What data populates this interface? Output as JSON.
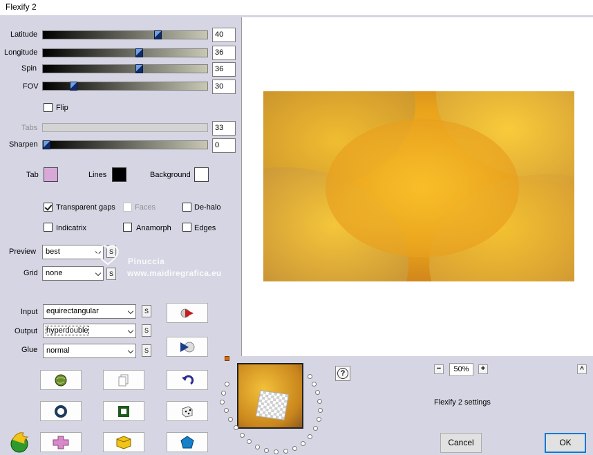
{
  "window": {
    "title": "Flexify 2"
  },
  "sliders": {
    "latitude": {
      "label": "Latitude",
      "value": "40",
      "fraction": 0.71
    },
    "longitude": {
      "label": "Longitude",
      "value": "36",
      "fraction": 0.59
    },
    "spin": {
      "label": "Spin",
      "value": "36",
      "fraction": 0.59
    },
    "fov": {
      "label": "FOV",
      "value": "30",
      "fraction": 0.17
    },
    "tabs": {
      "label": "Tabs",
      "value": "33",
      "disabled": true
    },
    "sharpen": {
      "label": "Sharpen",
      "value": "0",
      "fraction": 0.0
    }
  },
  "flip": {
    "label": "Flip",
    "checked": false
  },
  "colors": {
    "tab": {
      "label": "Tab",
      "color": "#d8a9d8"
    },
    "lines": {
      "label": "Lines",
      "color": "#000000"
    },
    "background": {
      "label": "Background",
      "color": "#ffffff"
    }
  },
  "options": {
    "transparent_gaps": {
      "label": "Transparent gaps",
      "checked": true
    },
    "faces": {
      "label": "Faces",
      "checked": false,
      "disabled": true
    },
    "de_halo": {
      "label": "De-halo",
      "checked": false
    },
    "indicatrix": {
      "label": "Indicatrix",
      "checked": false
    },
    "anamorph": {
      "label": "Anamorph",
      "checked": false
    },
    "edges": {
      "label": "Edges",
      "checked": false
    }
  },
  "preview": {
    "label": "Preview",
    "value": "best"
  },
  "grid": {
    "label": "Grid",
    "value": "none"
  },
  "input": {
    "label": "Input",
    "value": "equirectangular"
  },
  "output": {
    "label": "Output",
    "value": "hyperdouble"
  },
  "glue": {
    "label": "Glue",
    "value": "normal"
  },
  "s_label": "S",
  "watermark": {
    "line1": "Pinuccia",
    "line2": "www.maidiregrafica.eu"
  },
  "zoom": {
    "minus": "−",
    "value": "50%",
    "plus": "+"
  },
  "help": "?",
  "collapse": "^",
  "status_text": "Flexify 2 settings",
  "buttons": {
    "cancel": "Cancel",
    "ok": "OK"
  }
}
